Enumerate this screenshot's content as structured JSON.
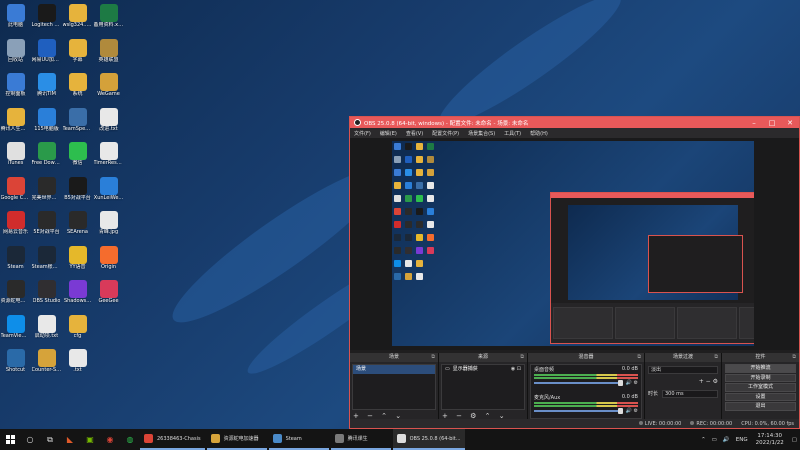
{
  "desktop": {
    "icons": [
      {
        "label": "此电脑",
        "icon": "computer-icon",
        "color": "#3a7bd5"
      },
      {
        "label": "Logitech G HUB",
        "icon": "logitech-g-icon",
        "color": "#1a1a1a"
      },
      {
        "label": "wslg324...6186313",
        "icon": "folder-icon",
        "color": "#e6b33c"
      },
      {
        "label": "备用资料.xlsx",
        "icon": "excel-icon",
        "color": "#1d7a44"
      },
      {
        "label": "回收站",
        "icon": "recycle-bin-icon",
        "color": "#8aa0b8"
      },
      {
        "label": "网易UU加速器",
        "icon": "uu-icon",
        "color": "#1f5fbf"
      },
      {
        "label": "字幕",
        "icon": "folder-icon",
        "color": "#e6b33c"
      },
      {
        "label": "英雄联盟",
        "icon": "lol-icon",
        "color": "#b08a3c"
      },
      {
        "label": "控制面板",
        "icon": "control-panel-icon",
        "color": "#3a7bd5"
      },
      {
        "label": "腾讯TIM",
        "icon": "tim-icon",
        "color": "#2a8ee6"
      },
      {
        "label": "系统",
        "icon": "folder-icon",
        "color": "#e6b33c"
      },
      {
        "label": "WeGame",
        "icon": "wegame-icon",
        "color": "#d4a13a"
      },
      {
        "label": "腾讯人生火影忍者",
        "icon": "folder-icon",
        "color": "#e6b33c"
      },
      {
        "label": "115电脑版",
        "icon": "app-115-icon",
        "color": "#2a7fd9"
      },
      {
        "label": "TeamSpeak 3",
        "icon": "teamspeak-icon",
        "color": "#3a6ea8"
      },
      {
        "label": "改进.txt",
        "icon": "text-file-icon",
        "color": "#e8e8e8"
      },
      {
        "label": "iTunes",
        "icon": "itunes-icon",
        "color": "#e0e0e0"
      },
      {
        "label": "Free Downlo...",
        "icon": "free-download-icon",
        "color": "#2a9a4a"
      },
      {
        "label": "微信",
        "icon": "wechat-icon",
        "color": "#2dbe4e"
      },
      {
        "label": "TimerResolu...",
        "icon": "timer-icon",
        "color": "#e8e8e8"
      },
      {
        "label": "Google Chrome",
        "icon": "chrome-icon",
        "color": "#db4437"
      },
      {
        "label": "完美世界竞技平台",
        "icon": "perfect-world-icon",
        "color": "#2a2a2a"
      },
      {
        "label": "B5对战平台",
        "icon": "b5-icon",
        "color": "#1a1a1a"
      },
      {
        "label": "XunLeiWe...",
        "icon": "xunlei-icon",
        "color": "#2a7fd9"
      },
      {
        "label": "网易云音乐",
        "icon": "netease-music-icon",
        "color": "#d12c2c"
      },
      {
        "label": "5E对战平台",
        "icon": "5e-icon",
        "color": "#2a2a2a"
      },
      {
        "label": "SEArena",
        "icon": "searena-icon",
        "color": "#2a2a2a"
      },
      {
        "label": "青峰.jpg",
        "icon": "image-file-icon",
        "color": "#e8e8e8"
      },
      {
        "label": "Steam",
        "icon": "steam-icon",
        "color": "#1b2838"
      },
      {
        "label": "Steam账户快速切换 V1...",
        "icon": "steam-switch-icon",
        "color": "#1b2838"
      },
      {
        "label": "YY语音",
        "icon": "yy-icon",
        "color": "#e5b82a"
      },
      {
        "label": "Origin",
        "icon": "origin-icon",
        "color": "#f56c2d"
      },
      {
        "label": "资源蛇电加速器",
        "icon": "accelerator-icon",
        "color": "#2a2a2a"
      },
      {
        "label": "OBS Studio",
        "icon": "obs-icon",
        "color": "#302e31"
      },
      {
        "label": "Shadows...",
        "icon": "shadowsocks-icon",
        "color": "#7a3ad4"
      },
      {
        "label": "GeeGee",
        "icon": "geegee-icon",
        "color": "#d83a5a"
      },
      {
        "label": "TeamViewer",
        "icon": "teamviewer-icon",
        "color": "#0e8ee9"
      },
      {
        "label": "启动项.txt",
        "icon": "text-file-icon",
        "color": "#e8e8e8"
      },
      {
        "label": "cfg",
        "icon": "folder-icon",
        "color": "#e6b33c"
      },
      {
        "label": "",
        "icon": "blank-slot-icon",
        "color": "transparent"
      },
      {
        "label": "Shotcut",
        "icon": "shotcut-icon",
        "color": "#2a6aa8"
      },
      {
        "label": "Counter-Strike: Global Off...",
        "icon": "csgo-icon",
        "color": "#d6a33a"
      },
      {
        "label": ".txt",
        "icon": "text-file-icon",
        "color": "#e8e8e8"
      }
    ]
  },
  "obs": {
    "title": "OBS 25.0.8 (64-bit, windows) - 配置文件: 未命名 - 场景: 未命名",
    "menu": [
      "文件(F)",
      "编辑(E)",
      "查看(V)",
      "配置文件(P)",
      "场景集合(S)",
      "工具(T)",
      "帮助(H)"
    ],
    "docks": {
      "scenes": {
        "title": "场景",
        "items": [
          "场景"
        ]
      },
      "sources": {
        "title": "来源",
        "items": [
          "显示器捕获"
        ]
      },
      "mixer": {
        "title": "混音器",
        "channels": [
          {
            "name": "桌面音频",
            "db": "0.0 dB"
          },
          {
            "name": "麦克风/Aux",
            "db": "0.0 dB"
          }
        ]
      },
      "transitions": {
        "title": "场景过渡",
        "type": "淡出",
        "duration_label": "时长",
        "duration": "300 ms"
      },
      "controls": {
        "title": "控件",
        "buttons": [
          "开始推流",
          "开始录制",
          "工作室模式",
          "设置",
          "退出"
        ]
      }
    },
    "status": {
      "live": "LIVE: 00:00:00",
      "rec": "REC: 00:00:00",
      "cpu": "CPU: 0.0%, 60.00 fps"
    }
  },
  "taskbar": {
    "apps": [
      {
        "label": "26338463-Chasis",
        "icon": "chrome-icon",
        "color": "#db4437"
      },
      {
        "label": "资源蛇电加速器",
        "icon": "accelerator-icon",
        "color": "#d6a33a"
      },
      {
        "label": "Steam",
        "icon": "steam-icon",
        "color": "#4a8ac8"
      },
      {
        "label": "腾讯课生",
        "icon": "tencent-icon",
        "color": "#7a7a7a"
      },
      {
        "label": "OBS 25.0.8 (64-bit...",
        "icon": "obs-icon",
        "color": "#dddddd"
      }
    ],
    "tray": {
      "lang": "ENG",
      "time": "17:14:30",
      "date": "2022/1/22"
    }
  }
}
